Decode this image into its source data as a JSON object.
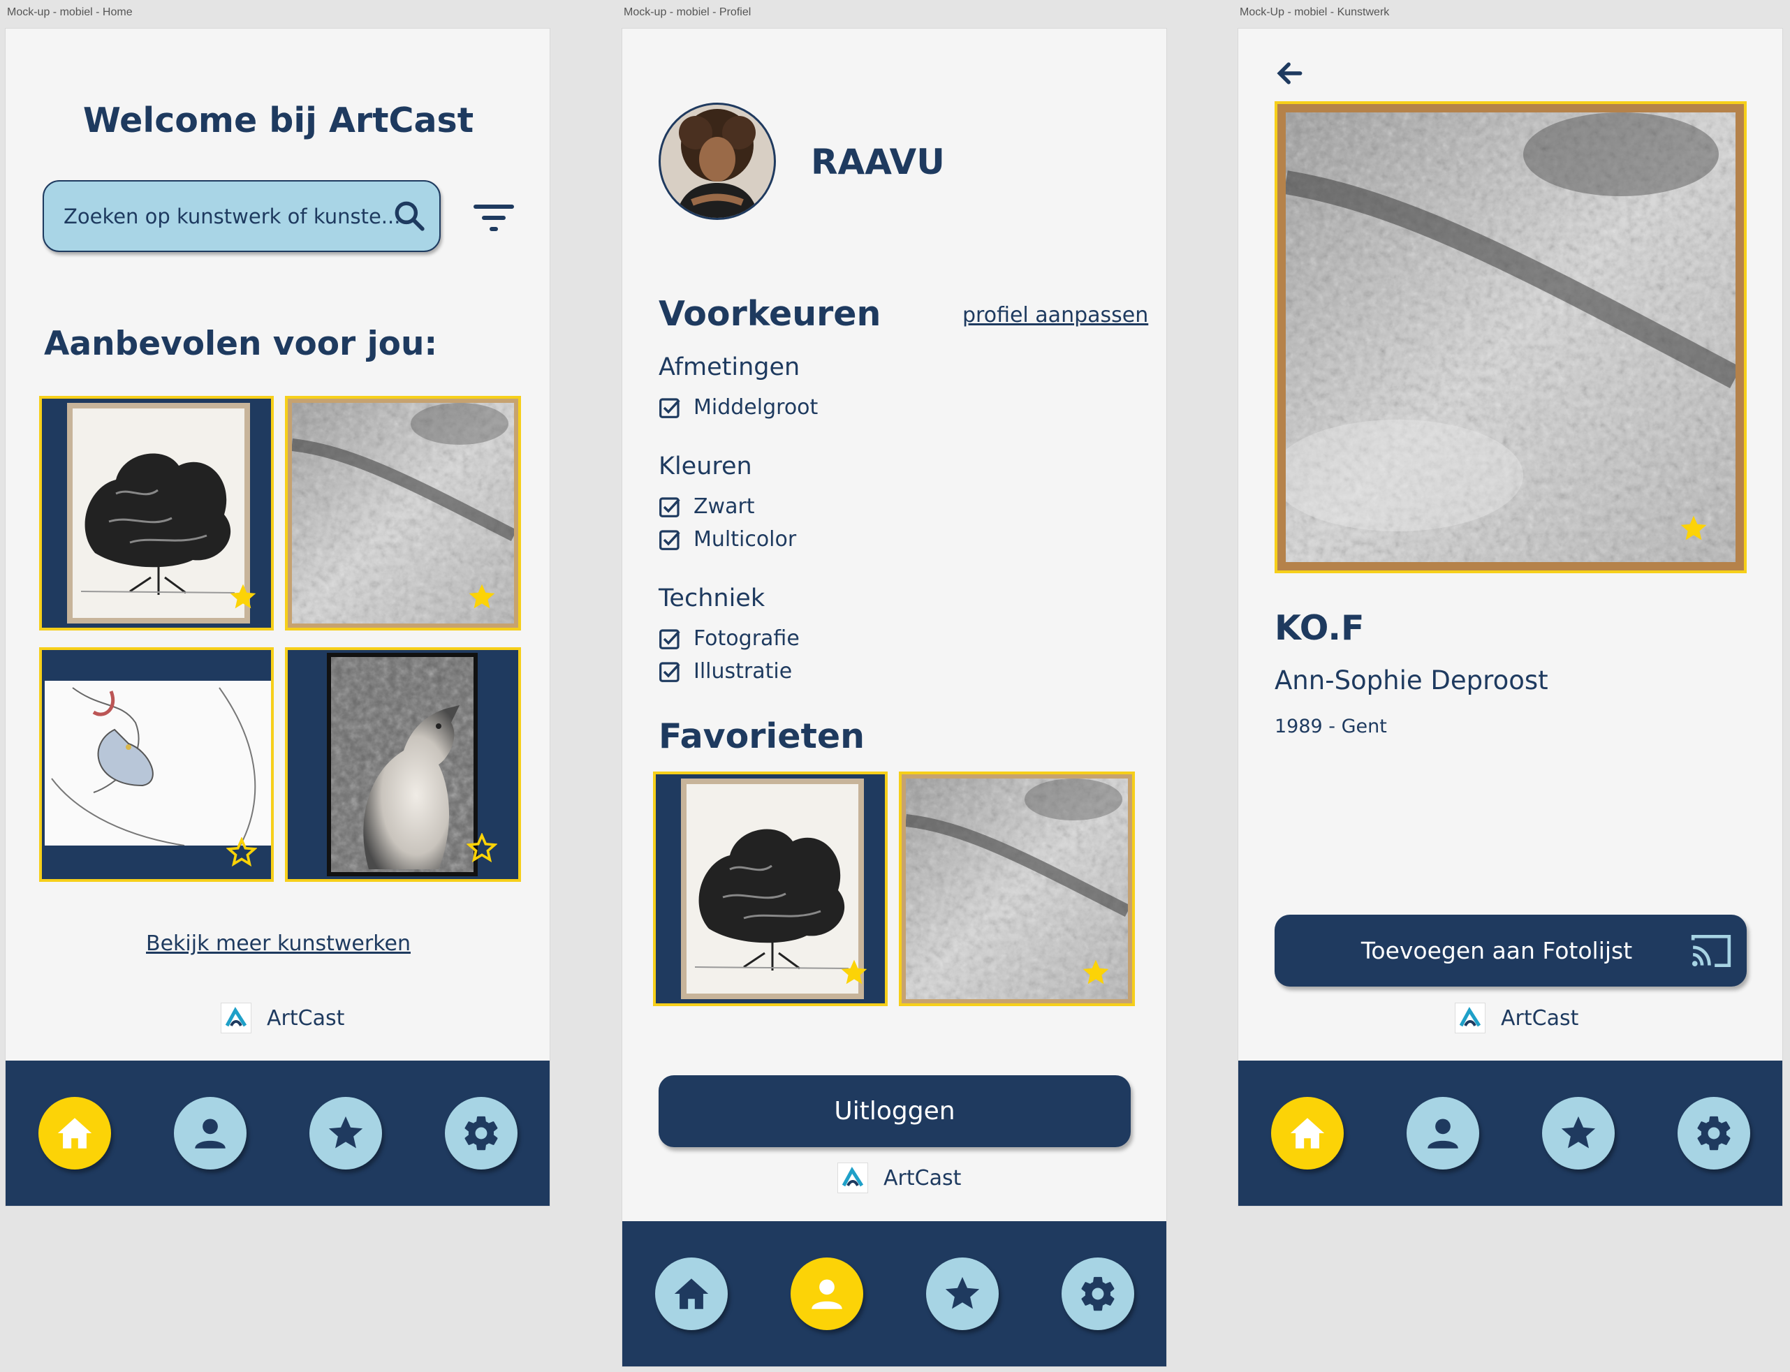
{
  "frames": {
    "home": "Mock-up  - mobiel - Home",
    "profile": "Mock-up  - mobiel - Profiel",
    "artwork": "Mock-Up  - mobiel - Kunstwerk"
  },
  "colors": {
    "primary": "#1f3a5f",
    "accent": "#fcd307",
    "light_blue": "#a7d4e4",
    "background": "#f5f5f5"
  },
  "brand": {
    "name": "ArtCast"
  },
  "nav": {
    "items": [
      {
        "icon": "home-icon"
      },
      {
        "icon": "user-icon"
      },
      {
        "icon": "star-icon"
      },
      {
        "icon": "gear-icon"
      }
    ]
  },
  "home": {
    "title": "Welcome bij ArtCast",
    "search_placeholder": "Zoeken op kunstwerk of kunste...",
    "section_title": "Aanbevolen voor jou:",
    "recommended": [
      {
        "art": "tree-drawing",
        "favorite": true
      },
      {
        "art": "grass-shadow-drawing",
        "favorite": true
      },
      {
        "art": "figure-line-drawing",
        "favorite": false
      },
      {
        "art": "dog-photo",
        "favorite": false
      }
    ],
    "more_link": "Bekijk meer kunstwerken",
    "active_nav": "home"
  },
  "profile": {
    "username": "RAAVU",
    "preferences_title": "Voorkeuren",
    "edit_link": "profiel aanpassen",
    "groups": [
      {
        "title": "Afmetingen",
        "options": [
          "Middelgroot"
        ]
      },
      {
        "title": "Kleuren",
        "options": [
          "Zwart",
          "Multicolor"
        ]
      },
      {
        "title": "Techniek",
        "options": [
          "Fotografie",
          "Illustratie"
        ]
      }
    ],
    "favorites_title": "Favorieten",
    "logout_label": "Uitloggen",
    "active_nav": "profile"
  },
  "artwork": {
    "title": "KO.F",
    "artist": "Ann-Sophie Deproost",
    "meta": "1989 - Gent",
    "add_button_label": "Toevoegen aan Fotolijst",
    "favorite": true,
    "active_nav": "home"
  }
}
